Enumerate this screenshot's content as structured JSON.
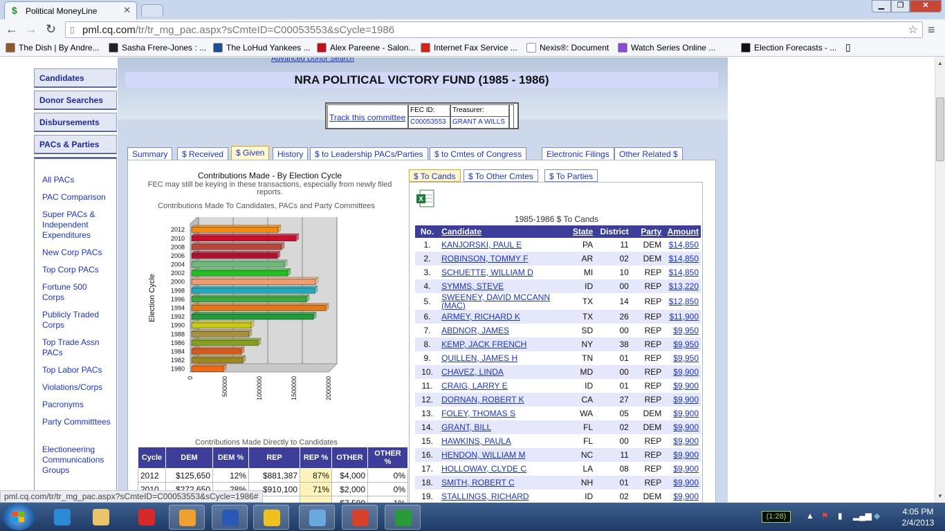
{
  "browser": {
    "tab_title": "Political MoneyLine",
    "url_host": "pml.cq.com",
    "url_path": "/tr/tr_mg_pac.aspx?sCmteID=C00053553&sCycle=1986",
    "bookmarks": [
      {
        "label": "The Dish | By Andre...",
        "color": "#8b5a2b"
      },
      {
        "label": "Sasha Frere-Jones : ...",
        "color": "#222222"
      },
      {
        "label": "The LoHud Yankees ...",
        "color": "#1e4c9a"
      },
      {
        "label": "Alex Pareene - Salon...",
        "color": "#c0121e"
      },
      {
        "label": "Internet Fax Service ...",
        "color": "#d4221c"
      },
      {
        "label": "Nexis®: Document",
        "color": "#ffffff"
      },
      {
        "label": "Watch Series Online ...",
        "color": "#8a4ad6"
      },
      {
        "label": "Election Forecasts - ...",
        "color": "#111111"
      }
    ]
  },
  "left_nav": {
    "main_buttons": [
      "Candidates",
      "Donor Searches",
      "Disbursements",
      "PACs & Parties"
    ],
    "sub_links": [
      "All PACs",
      "PAC Comparison",
      "Super PACs & Independent Expenditures",
      "New Corp PACs",
      "Top Corp PACs",
      "Fortune 500 Corps",
      "Publicly Traded Corps",
      "Top Trade Assn PACs",
      "Top Labor PACs",
      "Violations/Corps",
      "Pacronyms",
      "Party Committtees",
      "Electioneering Communications Groups"
    ]
  },
  "committee": {
    "top_link": "Advanced Donor Search",
    "title": "NRA POLITICAL VICTORY FUND (1985 - 1986)",
    "track_link": "Track this committee",
    "fec_label": "FEC ID:",
    "fec_id": "C00053553",
    "treasurer_label": "Treasurer:",
    "treasurer": "GRANT A WILLS"
  },
  "tabs_main": [
    {
      "label": "Summary",
      "active": false
    },
    {
      "label": "$ Received",
      "active": false
    },
    {
      "label": "$ Given",
      "active": true
    },
    {
      "label": "History",
      "active": false
    },
    {
      "label": "$ to Leadership PACs/Parties",
      "active": false
    },
    {
      "label": "$ to Cmtes of Congress",
      "active": false
    },
    {
      "label": "Electronic Filings",
      "active": false
    },
    {
      "label": "Other Related $",
      "active": false
    }
  ],
  "left_panel": {
    "heading": "Contributions Made - By Election Cycle",
    "note": "FEC may still be keying in these transactions, especially from newly filed reports.",
    "chart_caption": "Contributions Made To Candidates, PACs and Party Committees",
    "direct_caption": "Contributions Made Directly to Candidates"
  },
  "chart_data": {
    "type": "bar",
    "orientation": "horizontal",
    "title": "",
    "ylabel": "Election Cycle",
    "xlabel": "",
    "categories": [
      "2012",
      "2010",
      "2008",
      "2006",
      "2004",
      "2002",
      "2000",
      "1998",
      "1996",
      "1994",
      "1992",
      "1990",
      "1988",
      "1986",
      "1984",
      "1982",
      "1980"
    ],
    "values": [
      1270000,
      1530000,
      1320000,
      1260000,
      1360000,
      1410000,
      1810000,
      1800000,
      1680000,
      1960000,
      1780000,
      880000,
      850000,
      980000,
      740000,
      760000,
      480000
    ],
    "bar_colors": [
      "#f08a12",
      "#c8102e",
      "#b8463a",
      "#b01030",
      "#70b87a",
      "#22c022",
      "#f0a070",
      "#22a8b8",
      "#3aa83a",
      "#e07818",
      "#209a3a",
      "#c8c818",
      "#a89040",
      "#88a020",
      "#d85a18",
      "#a08820",
      "#f06a10"
    ],
    "xticks": [
      "0",
      "500000",
      "1000000",
      "1500000",
      "2000000"
    ],
    "xlim": [
      0,
      2000000
    ],
    "grid": true
  },
  "direct_table": {
    "headers": [
      "Cycle",
      "DEM",
      "DEM %",
      "REP",
      "REP %",
      "OTHER",
      "OTHER %"
    ],
    "rows": [
      [
        "2012",
        "$125,650",
        "12%",
        "$881,387",
        "87%",
        "$4,000",
        "0%"
      ],
      [
        "2010",
        "$272,650",
        "28%",
        "$910,100",
        "71%",
        "$2,000",
        "0%"
      ],
      [
        "2008",
        "",
        "",
        "",
        "",
        "$7,500",
        "1%"
      ]
    ]
  },
  "right_panel": {
    "tabs": [
      {
        "label": "$ To Cands",
        "active": true
      },
      {
        "label": "$ To Other Cmtes",
        "active": false
      },
      {
        "label": "$ To Parties",
        "active": false
      }
    ],
    "title": "1985-1986 $ To Cands",
    "headers": [
      "No.",
      "Candidate",
      "State",
      "District",
      "Party",
      "Amount"
    ],
    "rows": [
      [
        "1.",
        "KANJORSKI, PAUL E",
        "PA",
        "11",
        "DEM",
        "$14,850"
      ],
      [
        "2.",
        "ROBINSON, TOMMY F",
        "AR",
        "02",
        "DEM",
        "$14,850"
      ],
      [
        "3.",
        "SCHUETTE, WILLIAM D",
        "MI",
        "10",
        "REP",
        "$14,850"
      ],
      [
        "4.",
        "SYMMS, STEVE",
        "ID",
        "00",
        "REP",
        "$13,220"
      ],
      [
        "5.",
        "SWEENEY, DAVID MCCANN (MAC)",
        "TX",
        "14",
        "REP",
        "$12,850"
      ],
      [
        "6.",
        "ARMEY, RICHARD K",
        "TX",
        "26",
        "REP",
        "$11,900"
      ],
      [
        "7.",
        "ABDNOR, JAMES",
        "SD",
        "00",
        "REP",
        "$9,950"
      ],
      [
        "8.",
        "KEMP, JACK FRENCH",
        "NY",
        "38",
        "REP",
        "$9,950"
      ],
      [
        "9.",
        "QUILLEN, JAMES H",
        "TN",
        "01",
        "REP",
        "$9,950"
      ],
      [
        "10.",
        "CHAVEZ, LINDA",
        "MD",
        "00",
        "REP",
        "$9,900"
      ],
      [
        "11.",
        "CRAIG, LARRY E",
        "ID",
        "01",
        "REP",
        "$9,900"
      ],
      [
        "12.",
        "DORNAN, ROBERT K",
        "CA",
        "27",
        "REP",
        "$9,900"
      ],
      [
        "13.",
        "FOLEY, THOMAS S",
        "WA",
        "05",
        "DEM",
        "$9,900"
      ],
      [
        "14.",
        "GRANT, BILL",
        "FL",
        "02",
        "DEM",
        "$9,900"
      ],
      [
        "15.",
        "HAWKINS, PAULA",
        "FL",
        "00",
        "REP",
        "$9,900"
      ],
      [
        "16.",
        "HENDON, WILLIAM M",
        "NC",
        "11",
        "REP",
        "$9,900"
      ],
      [
        "17.",
        "HOLLOWAY, CLYDE C",
        "LA",
        "08",
        "REP",
        "$9,900"
      ],
      [
        "18.",
        "SMITH, ROBERT C",
        "NH",
        "01",
        "REP",
        "$9,900"
      ],
      [
        "19.",
        "STALLINGS, RICHARD",
        "ID",
        "02",
        "DEM",
        "$9,900"
      ]
    ]
  },
  "status_bar": "pml.cq.com/tr/tr_mg_pac.aspx?sCmteID=C00053553&sCycle=1986#",
  "taskbar": {
    "battery": "(1:28)",
    "time": "4:05 PM",
    "date": "2/4/2013",
    "apps": [
      {
        "name": "ie",
        "color": "#2a8ad6"
      },
      {
        "name": "explorer",
        "color": "#e8c46a"
      },
      {
        "name": "app-red",
        "color": "#d42a2a"
      },
      {
        "name": "media",
        "color": "#f0a030"
      },
      {
        "name": "word",
        "color": "#2a5ab8"
      },
      {
        "name": "talk",
        "color": "#f0c020"
      },
      {
        "name": "control-panel",
        "color": "#6aa8e0"
      },
      {
        "name": "chrome",
        "color": "#d8402a"
      },
      {
        "name": "excel",
        "color": "#2a9a3a"
      }
    ]
  }
}
